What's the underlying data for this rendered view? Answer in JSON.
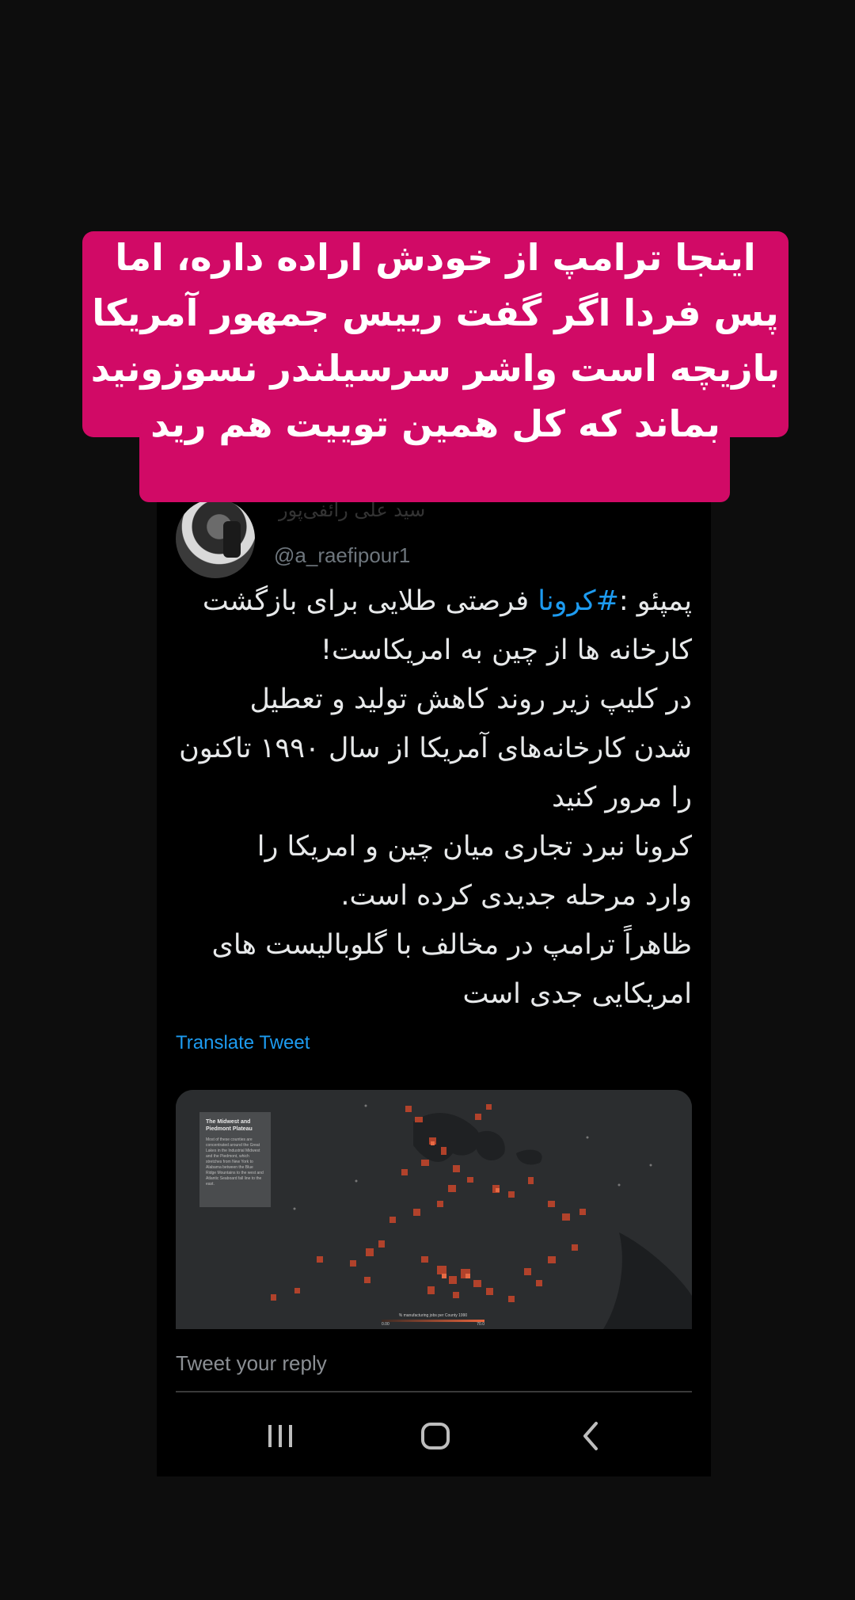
{
  "tweet": {
    "display_name": "سید علی رائفی‌پور",
    "handle": "@a_raefipour1",
    "body_lines": [
      {
        "pre": "پمپئو :",
        "hashtag": "#کرونا",
        "post": " فرصتی طلایی برای بازگشت"
      },
      "کارخانه ها از چین به امریکاست!",
      "در کلیپ زیر روند کاهش تولید و تعطیل",
      "شدن کارخانه‌های آمریکا از سال ۱۹۹۰ تاکنون",
      "را مرور کنید",
      "کرونا نبرد تجاری میان چین و امریکا را",
      "وارد مرحله جدیدی کرده است.",
      "ظاهراً ترامپ در مخالف با گلوبالیست های",
      "امریکایی جدی است"
    ],
    "translate_label": "Translate Tweet",
    "media": {
      "map_title": "The Midwest and Piedmont Plateau",
      "map_text": "Most of these counties are concentrated around the Great Lakes in the Industrial Midwest and the Piedmont, which stretches from New York to Alabama between the Blue Ridge Mountains to the west and Atlantic Seaboard fall line to the east.",
      "legend": "% manufacturing jobs per County 1990",
      "legend_min": "0.00",
      "legend_max": "70.0"
    }
  },
  "reply": {
    "placeholder": "Tweet your reply"
  },
  "overlay_caption": {
    "lines": [
      "اینجا ترامپ از خودش اراده داره، اما",
      "پس فردا اگر گفت رییس جمهور آمریکا",
      "بازیچه است واشر سرسیلندر نسوزونید",
      "بماند که کل همین توییت هم رید"
    ],
    "bg_color": "#d10a66"
  },
  "navbar": {
    "icons": [
      "recent-apps-icon",
      "home-icon",
      "back-icon"
    ]
  }
}
